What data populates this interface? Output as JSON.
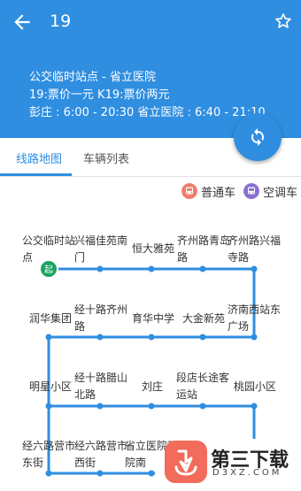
{
  "header": {
    "title": "19",
    "line1": "公交临时站点 - 省立医院",
    "line2": "19:票价一元 K19:票价两元",
    "line3": "彭庄 : 6:00 - 20:30 省立医院 : 6:40 - 21:10"
  },
  "tabs": [
    {
      "label": "线路地图"
    },
    {
      "label": "车辆列表"
    }
  ],
  "legend": {
    "regular": "普通车",
    "ac": "空调车"
  },
  "start_marker": "起",
  "stops": [
    "公交临时站点",
    "兴福佳苑南门",
    "恒大雅苑",
    "齐州路青岛路",
    "齐州路兴福寺路",
    "润华集团",
    "经十路齐州路",
    "育华中学",
    "大金新苑",
    "济南西站东广场",
    "明星小区",
    "经十路腊山北路",
    "刘庄",
    "段店长途客运站",
    "桃园小区",
    "经六路营市东街",
    "经六路营市西街",
    "省立医院西院南"
  ],
  "colors": {
    "primary": "#2f8ee0",
    "route": "#2f8ee0",
    "start": "#1aa260",
    "regular_bus": "#f07d6a",
    "ac_bus": "#8a6fd0"
  },
  "watermark": {
    "title": "第三下载",
    "sub": "D3XZ.COM"
  }
}
